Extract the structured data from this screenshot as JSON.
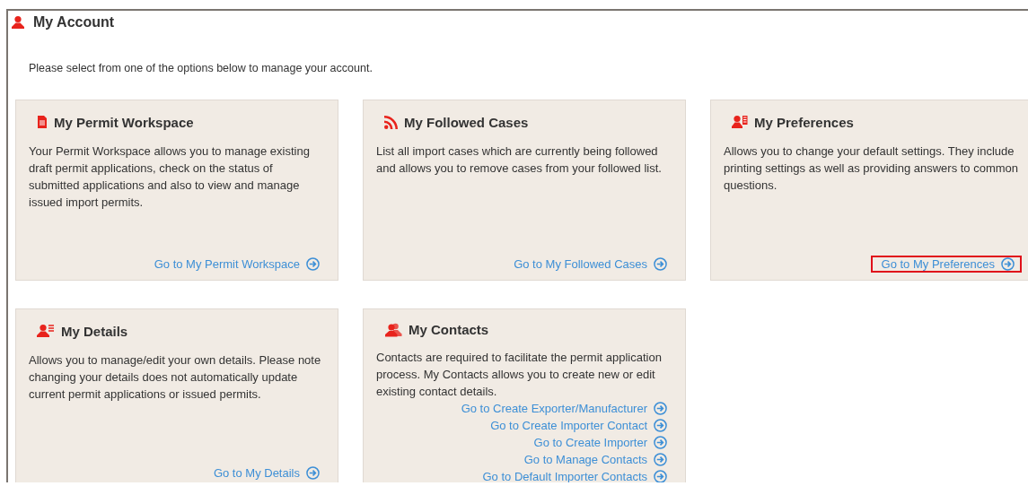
{
  "page": {
    "title": "My Account",
    "intro": "Please select from one of the options below to manage your account."
  },
  "cards": [
    {
      "title": "My Permit Workspace",
      "description": "Your Permit Workspace allows you to manage existing draft permit applications, check on the status of submitted applications and also to view and manage issued import permits.",
      "links": [
        {
          "label": "Go to My Permit Workspace",
          "highlighted": false
        }
      ]
    },
    {
      "title": "My Followed Cases",
      "description": "List all import cases which are currently being followed and allows you to remove cases from your followed list.",
      "links": [
        {
          "label": "Go to My Followed Cases",
          "highlighted": false
        }
      ]
    },
    {
      "title": "My Preferences",
      "description": "Allows you to change your default settings. They include printing settings as well as providing answers to common questions.",
      "links": [
        {
          "label": "Go to My Preferences",
          "highlighted": true
        }
      ]
    },
    {
      "title": "My Details",
      "description": "Allows you to manage/edit your own details. Please note changing your details does not automatically update current permit applications or issued permits.",
      "links": [
        {
          "label": "Go to My Details",
          "highlighted": false
        }
      ]
    },
    {
      "title": "My Contacts",
      "description": "Contacts are required to facilitate the permit application process. My Contacts allows you to create new or edit existing contact details.",
      "links": [
        {
          "label": "Go to Create Exporter/Manufacturer",
          "highlighted": false
        },
        {
          "label": "Go to Create Importer Contact",
          "highlighted": false
        },
        {
          "label": "Go to Create Importer",
          "highlighted": false
        },
        {
          "label": "Go to Manage Contacts",
          "highlighted": false
        },
        {
          "label": "Go to Default Importer Contacts",
          "highlighted": false
        }
      ]
    }
  ]
}
